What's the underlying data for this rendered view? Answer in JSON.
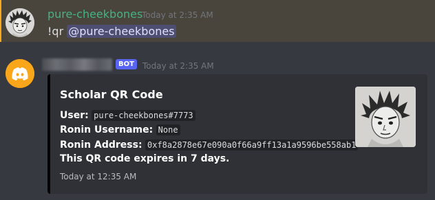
{
  "message1": {
    "username": "pure-cheekbones",
    "timestamp": "Today at 2:35 AM",
    "command": "!qr",
    "mention": "@pure-cheekbones"
  },
  "message2": {
    "bot_tag": "BOT",
    "timestamp": "Today at 2:35 AM",
    "embed": {
      "title": "Scholar QR Code",
      "fields": {
        "user_label": "User:",
        "user_value": "pure-cheekbones#7773",
        "ronin_username_label": "Ronin Username:",
        "ronin_username_value": "None",
        "ronin_address_label": "Ronin Address:",
        "ronin_address_value": "0xf8a2878e67e090a0f66a9ff13a1a9596be558ab1"
      },
      "expiry_text": "This QR code expires in 7 days.",
      "footer_timestamp": "Today at 12:35 AM",
      "accent_color": "#050505"
    },
    "avatar_color": "#faa61a"
  },
  "colors": {
    "background": "#36393f",
    "mention_highlight": "#49443c",
    "username_green": "#43b581",
    "bot_tag": "#5865f2"
  },
  "icons": {
    "bot_avatar": "discord-logo-icon",
    "user_avatar": "sketch-portrait-avatar"
  }
}
